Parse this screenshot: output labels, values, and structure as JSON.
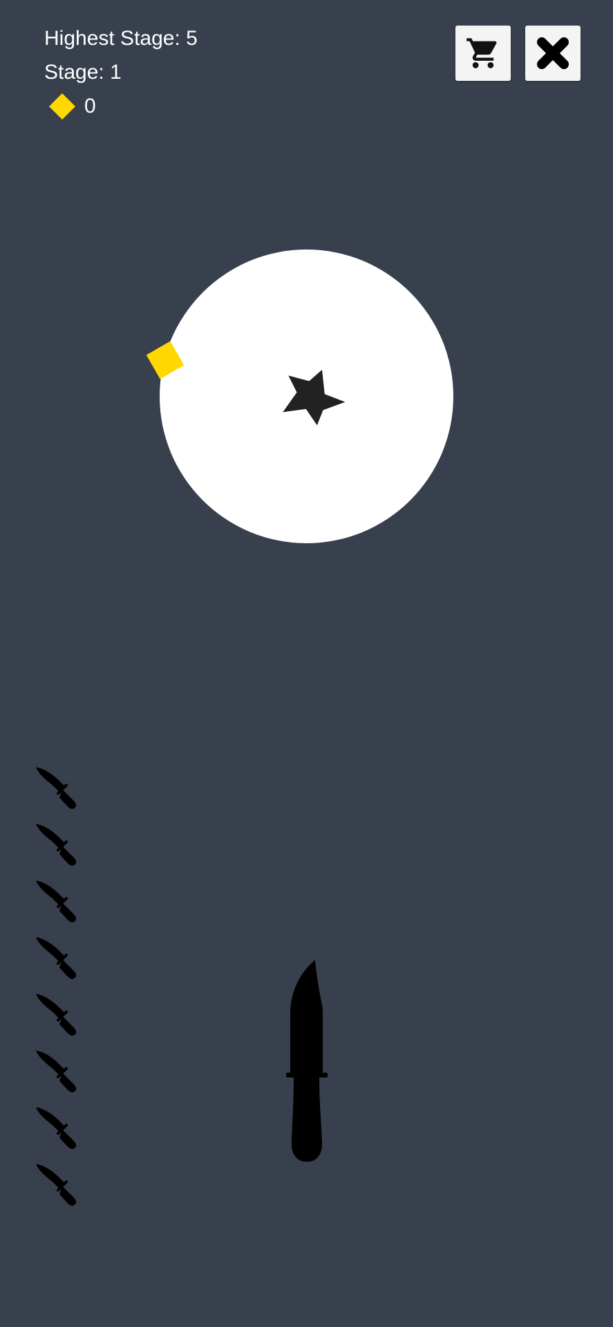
{
  "hud": {
    "highest_stage_label": "Highest Stage: 5",
    "stage_label": "Stage: 1",
    "gem_count": "0"
  },
  "buttons": {
    "shop_icon": "shopping-cart-icon",
    "close_icon": "close-x-icon"
  },
  "game": {
    "knives_remaining": 8,
    "target_icon": "star-icon",
    "stuck_item": "gem-icon"
  },
  "colors": {
    "background": "#383f4d",
    "target": "#ffffff",
    "gem": "#ffd800",
    "knife": "#000000",
    "star": "#222222",
    "button": "#f4f4f4"
  }
}
